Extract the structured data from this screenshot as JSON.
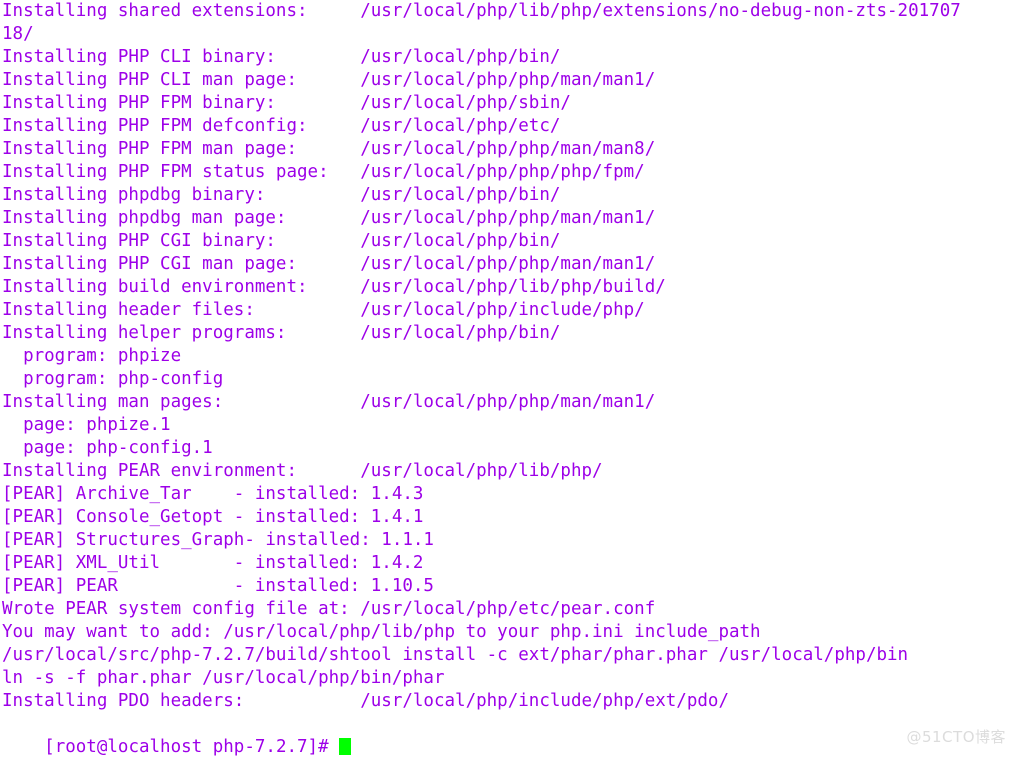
{
  "terminal": {
    "title": "Terminal",
    "foreground_color": "#9d00e8",
    "background_color": "#ffffff",
    "cursor_color": "#00ff00",
    "watermark": "@51CTO博客",
    "prompt": "[root@localhost php-7.2.7]# ",
    "lines": [
      "Installing shared extensions:     /usr/local/php/lib/php/extensions/no-debug-non-zts-201707",
      "18/",
      "Installing PHP CLI binary:        /usr/local/php/bin/",
      "Installing PHP CLI man page:      /usr/local/php/php/man/man1/",
      "Installing PHP FPM binary:        /usr/local/php/sbin/",
      "Installing PHP FPM defconfig:     /usr/local/php/etc/",
      "Installing PHP FPM man page:      /usr/local/php/php/man/man8/",
      "Installing PHP FPM status page:   /usr/local/php/php/php/fpm/",
      "Installing phpdbg binary:         /usr/local/php/bin/",
      "Installing phpdbg man page:       /usr/local/php/php/man/man1/",
      "Installing PHP CGI binary:        /usr/local/php/bin/",
      "Installing PHP CGI man page:      /usr/local/php/php/man/man1/",
      "Installing build environment:     /usr/local/php/lib/php/build/",
      "Installing header files:          /usr/local/php/include/php/",
      "Installing helper programs:       /usr/local/php/bin/",
      "  program: phpize",
      "  program: php-config",
      "Installing man pages:             /usr/local/php/php/man/man1/",
      "  page: phpize.1",
      "  page: php-config.1",
      "Installing PEAR environment:      /usr/local/php/lib/php/",
      "[PEAR] Archive_Tar    - installed: 1.4.3",
      "[PEAR] Console_Getopt - installed: 1.4.1",
      "[PEAR] Structures_Graph- installed: 1.1.1",
      "[PEAR] XML_Util       - installed: 1.4.2",
      "[PEAR] PEAR           - installed: 1.10.5",
      "Wrote PEAR system config file at: /usr/local/php/etc/pear.conf",
      "You may want to add: /usr/local/php/lib/php to your php.ini include_path",
      "/usr/local/src/php-7.2.7/build/shtool install -c ext/phar/phar.phar /usr/local/php/bin",
      "ln -s -f phar.phar /usr/local/php/bin/phar",
      "Installing PDO headers:           /usr/local/php/include/php/ext/pdo/"
    ]
  }
}
